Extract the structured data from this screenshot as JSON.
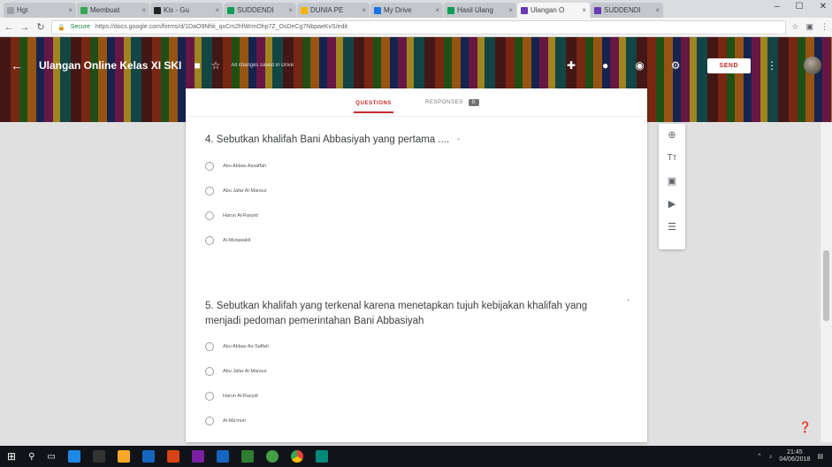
{
  "browser": {
    "tabs": [
      {
        "label": "Hgt",
        "color": "#9aa0a6",
        "active": false
      },
      {
        "label": "Membuat",
        "color": "#34a853",
        "active": false
      },
      {
        "label": "Kis - Gu",
        "color": "#202124",
        "active": false
      },
      {
        "label": "SUDDENDI",
        "color": "#0f9d58",
        "active": false
      },
      {
        "label": "DUNIA PE",
        "color": "#f4b400",
        "active": false
      },
      {
        "label": "My Drive",
        "color": "#1a73e8",
        "active": false
      },
      {
        "label": "Hasil Ulang",
        "color": "#0f9d58",
        "active": false
      },
      {
        "label": "Ulangan O",
        "color": "#673ab7",
        "active": true
      },
      {
        "label": "SUDDENDI",
        "color": "#673ab7",
        "active": false
      }
    ],
    "address": {
      "secure_label": "Secure",
      "url": "https://docs.google.com/forms/d/1DaO9Nhk_qxCm2hfWrmOhp7Z_OsDeCg7NbpaeKvS/edit"
    }
  },
  "header": {
    "title": "Ulangan Online Kelas XI SKI",
    "saved_text": "All changes saved in Drive",
    "send_label": "SEND",
    "accent": "#c62828"
  },
  "form": {
    "tabs": {
      "questions": "QUESTIONS",
      "responses": "RESPONSES",
      "responses_count": "0"
    },
    "questions": [
      {
        "title": "4. Sebutkan khalifah Bani Abbasiyah yang pertama .... ",
        "required_mark": "*",
        "options": [
          "Abu Abbas Assaffah",
          "Abu Jafar Al-Mansur",
          "Harun Al-Rasyid",
          "Al-Mutawakil"
        ]
      },
      {
        "title": "5. Sebutkan khalifah yang terkenal karena menetapkan tujuh kebijakan khalifah yang menjadi pedoman pemerintahan Bani Abbasiyah",
        "required_mark": "*",
        "options": [
          "Abu Abbas As-Saffah",
          "Abu Jafar Al-Mansur",
          "Harun Al-Rasyid",
          "Al-Ma'mun"
        ]
      }
    ]
  },
  "taskbar": {
    "time": "21:45",
    "date": "04/06/2018"
  }
}
